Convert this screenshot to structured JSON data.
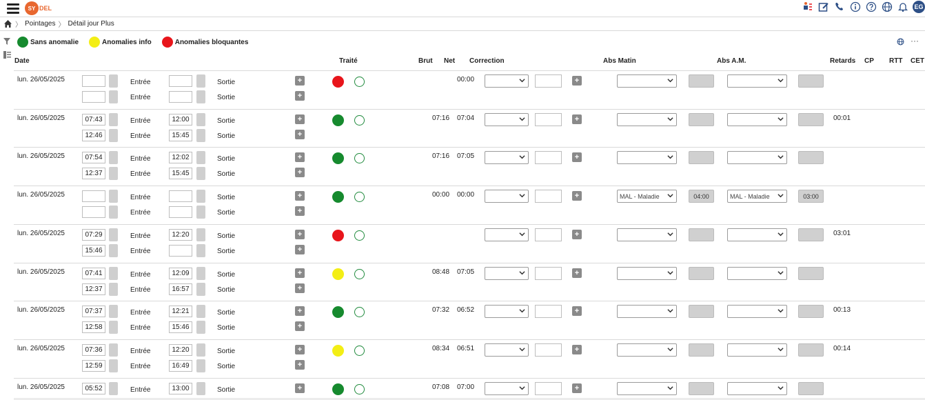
{
  "app": {
    "logo_text": "SYDEL",
    "avatar_initials": "EG"
  },
  "breadcrumb": [
    "Pointages",
    "Détail jour Plus"
  ],
  "legend": [
    {
      "label": "Sans anomalie",
      "color": "#168a2e"
    },
    {
      "label": "Anomalies info",
      "color": "#f3ee15"
    },
    {
      "label": "Anomalies bloquantes",
      "color": "#e8151b"
    }
  ],
  "headers": {
    "date": "Date",
    "traite": "Traité",
    "brut": "Brut",
    "net": "Net",
    "correction": "Correction",
    "abs_matin": "Abs Matin",
    "abs_am": "Abs A.M.",
    "retards": "Retards",
    "cp": "CP",
    "rtt": "RTT",
    "cet": "CET"
  },
  "labels": {
    "entree": "Entrée",
    "sortie": "Sortie",
    "plus": "+"
  },
  "colors": {
    "green": "#168a2e",
    "yellow": "#f3ee15",
    "red": "#e8151b"
  },
  "rows": [
    {
      "date": "lun. 26/05/2025",
      "in1": "",
      "out1": "",
      "in2": "",
      "out2": "",
      "lbl2a": "Entrée",
      "lbl2b": "Sortie",
      "status": "red",
      "brut": "",
      "net": "00:00",
      "abs_matin": "",
      "abs_matin_h": "",
      "abs_am": "",
      "abs_am_h": "",
      "retard": ""
    },
    {
      "date": "lun. 26/05/2025",
      "in1": "07:43",
      "out1": "12:00",
      "in2": "12:46",
      "out2": "15:45",
      "lbl2a": "Entrée",
      "lbl2b": "Sortie",
      "status": "green",
      "brut": "07:16",
      "net": "07:04",
      "abs_matin": "",
      "abs_matin_h": "",
      "abs_am": "",
      "abs_am_h": "",
      "retard": "00:01"
    },
    {
      "date": "lun. 26/05/2025",
      "in1": "07:54",
      "out1": "12:02",
      "in2": "12:37",
      "out2": "15:45",
      "lbl2a": "Entrée",
      "lbl2b": "Sortie",
      "status": "green",
      "brut": "07:16",
      "net": "07:05",
      "abs_matin": "",
      "abs_matin_h": "",
      "abs_am": "",
      "abs_am_h": "",
      "retard": ""
    },
    {
      "date": "lun. 26/05/2025",
      "in1": "",
      "out1": "",
      "in2": "",
      "out2": "",
      "lbl2a": "Entrée",
      "lbl2b": "Sortie",
      "status": "green",
      "brut": "00:00",
      "net": "00:00",
      "abs_matin": "MAL - Maladie",
      "abs_matin_h": "04:00",
      "abs_am": "MAL - Maladie",
      "abs_am_h": "03:00",
      "retard": ""
    },
    {
      "date": "lun. 26/05/2025",
      "in1": "07:29",
      "out1": "12:20",
      "in2": "15:46",
      "out2": "",
      "lbl2a": "Entrée",
      "lbl2b": "Sortie",
      "status": "red",
      "brut": "",
      "net": "",
      "abs_matin": "",
      "abs_matin_h": "",
      "abs_am": "",
      "abs_am_h": "",
      "retard": "03:01"
    },
    {
      "date": "lun. 26/05/2025",
      "in1": "07:41",
      "out1": "12:09",
      "in2": "12:37",
      "out2": "16:57",
      "lbl2a": "Entrée",
      "lbl2b": "Sortie",
      "status": "yellow",
      "brut": "08:48",
      "net": "07:05",
      "abs_matin": "",
      "abs_matin_h": "",
      "abs_am": "",
      "abs_am_h": "",
      "retard": ""
    },
    {
      "date": "lun. 26/05/2025",
      "in1": "07:37",
      "out1": "12:21",
      "in2": "12:58",
      "out2": "15:46",
      "lbl2a": "Entrée",
      "lbl2b": "Sortie",
      "status": "green",
      "brut": "07:32",
      "net": "06:52",
      "abs_matin": "",
      "abs_matin_h": "",
      "abs_am": "",
      "abs_am_h": "",
      "retard": "00:13"
    },
    {
      "date": "lun. 26/05/2025",
      "in1": "07:36",
      "out1": "12:20",
      "in2": "12:59",
      "out2": "16:49",
      "lbl2a": "Entrée",
      "lbl2b": "Sortie",
      "status": "yellow",
      "brut": "08:34",
      "net": "06:51",
      "abs_matin": "",
      "abs_matin_h": "",
      "abs_am": "",
      "abs_am_h": "",
      "retard": "00:14"
    },
    {
      "date": "lun. 26/05/2025",
      "in1": "05:52",
      "out1": "13:00",
      "in2": "",
      "out2": "",
      "lbl2a": "",
      "lbl2b": "",
      "status": "green",
      "brut": "07:08",
      "net": "07:00",
      "abs_matin": "",
      "abs_matin_h": "",
      "abs_am": "",
      "abs_am_h": "",
      "retard": ""
    }
  ]
}
